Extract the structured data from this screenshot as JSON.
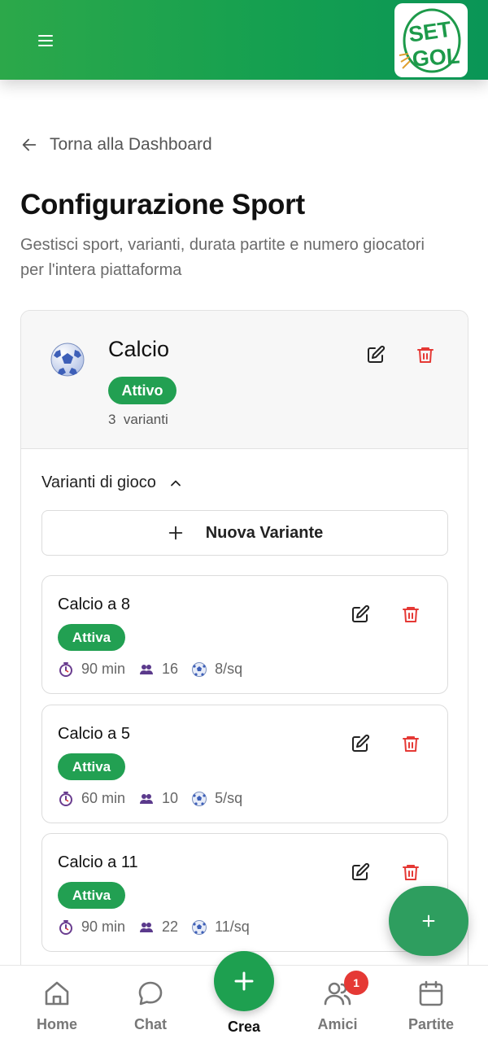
{
  "header": {
    "menu_icon": "hamburger-icon",
    "logo_text": "SET GOL"
  },
  "back_link": {
    "label": "Torna alla Dashboard"
  },
  "page": {
    "title": "Configurazione Sport",
    "subtitle": "Gestisci sport, varianti, durata partite e numero giocatori per l'intera piattaforma"
  },
  "sport": {
    "name": "Calcio",
    "status": "Attivo",
    "variant_count": "3",
    "variant_count_label": "varianti",
    "variants_section_title": "Varianti di gioco",
    "new_variant_label": "Nuova Variante",
    "variants": [
      {
        "name": "Calcio a 8",
        "status": "Attiva",
        "duration": "90 min",
        "players": "16",
        "per_team": "8/sq"
      },
      {
        "name": "Calcio a 5",
        "status": "Attiva",
        "duration": "60 min",
        "players": "10",
        "per_team": "5/sq"
      },
      {
        "name": "Calcio a 11",
        "status": "Attiva",
        "duration": "90 min",
        "players": "22",
        "per_team": "11/sq"
      }
    ]
  },
  "bottom_nav": {
    "items": [
      {
        "label": "Home",
        "icon": "home-icon"
      },
      {
        "label": "Chat",
        "icon": "chat-icon"
      },
      {
        "label": "Crea",
        "icon": "plus-icon"
      },
      {
        "label": "Amici",
        "icon": "friends-icon",
        "badge": "1"
      },
      {
        "label": "Partite",
        "icon": "calendar-icon"
      }
    ]
  },
  "colors": {
    "brand_green": "#1ea050",
    "danger_red": "#e53935",
    "badge_green": "#22a052"
  }
}
